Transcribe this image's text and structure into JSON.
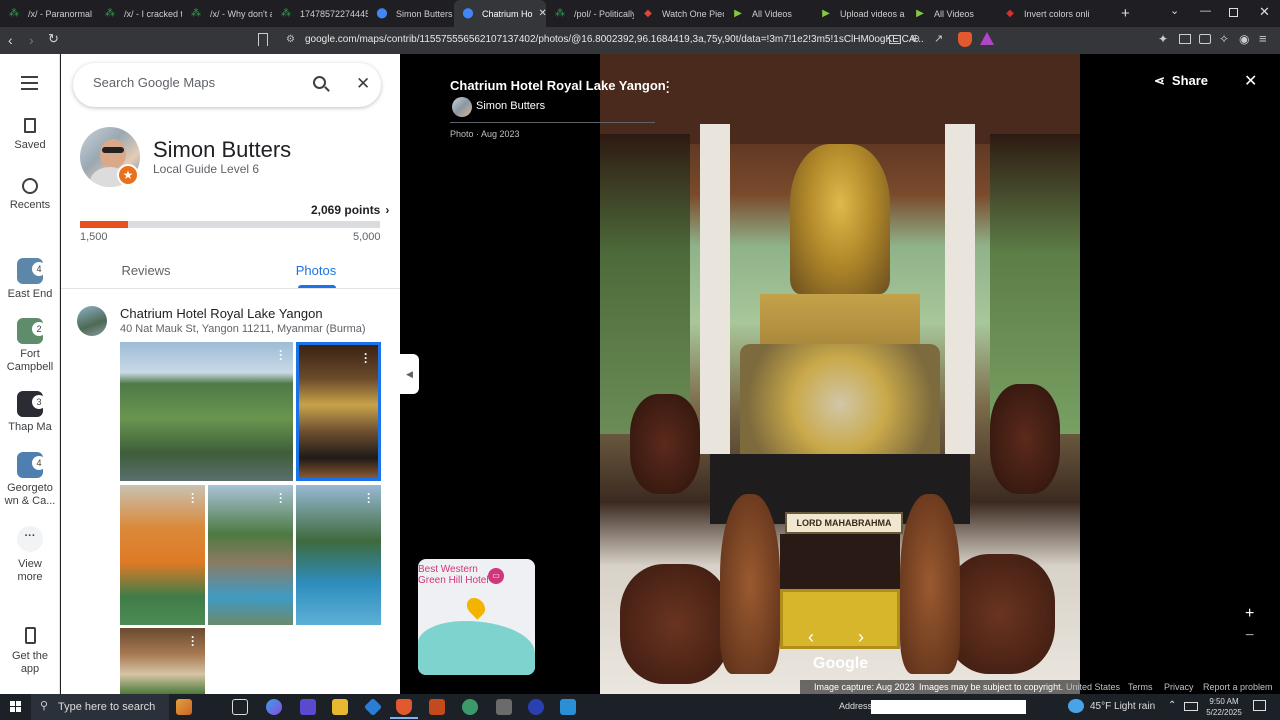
{
  "browser": {
    "tabs": [
      {
        "label": "/x/ - Paranormal",
        "icon": "4chan-icon",
        "color": "#2e9e4f"
      },
      {
        "label": "/x/ - I cracked the",
        "icon": "4chan-icon",
        "color": "#2e9e4f"
      },
      {
        "label": "/x/ - Why don't a",
        "icon": "4chan-icon",
        "color": "#2e9e4f"
      },
      {
        "label": "17478572274445",
        "icon": "4chan-icon",
        "color": "#2e9e4f"
      },
      {
        "label": "Simon Butters - G",
        "icon": "maps-pin-icon",
        "color": "#4285f4"
      },
      {
        "label": "Chatrium Ho",
        "icon": "maps-pin-icon",
        "color": "#4285f4",
        "active": true
      },
      {
        "label": "/pol/ - Politically",
        "icon": "4chan-icon",
        "color": "#2e9e4f"
      },
      {
        "label": "Watch One Piece",
        "icon": "crunchyroll-icon",
        "color": "#e0463a"
      },
      {
        "label": "All Videos",
        "icon": "rumble-icon",
        "color": "#85c742"
      },
      {
        "label": "Upload videos a",
        "icon": "rumble-icon",
        "color": "#85c742"
      },
      {
        "label": "All Videos",
        "icon": "rumble-icon",
        "color": "#85c742"
      },
      {
        "label": "Invert colors onli",
        "icon": "invert-icon",
        "color": "#d9302c"
      }
    ],
    "url": "google.com/maps/contrib/115575556562107137402/photos/@16.8002392,96.1684419,3a,75y,90t/data=!3m7!1e2!3m5!1sClHM0ogKEICA..."
  },
  "rail": {
    "saved": "Saved",
    "recents": "Recents",
    "recent_places": [
      {
        "label": "East End",
        "count": "4",
        "color": "#5d87a8"
      },
      {
        "label": "Fort Campbell",
        "count": "2",
        "color": "#5f8d6b"
      },
      {
        "label": "Thap Ma",
        "count": "3",
        "color": "#2b2b33"
      },
      {
        "label": "Georgeto wn & Ca...",
        "count": "4",
        "color": "#4f7fb0"
      }
    ],
    "view_more": "View more",
    "get_app": "Get the app"
  },
  "search": {
    "placeholder": "Search Google Maps"
  },
  "profile": {
    "name": "Simon Butters",
    "level": "Local Guide Level 6",
    "points": "2,069 points",
    "progress_min": "1,500",
    "progress_max": "5,000",
    "progress_fraction": 0.16
  },
  "tabs": {
    "reviews": "Reviews",
    "photos": "Photos"
  },
  "place": {
    "name": "Chatrium Hotel Royal Lake Yangon",
    "address": "40 Nat Mauk St, Yangon 11211, Myanmar (Burma)"
  },
  "viewer": {
    "title": "Chatrium Hotel Royal Lake Yangon",
    "author": "Simon Butters",
    "date": "Photo · Aug 2023",
    "share": "Share",
    "sign_text": "LORD MAHABRAHMA",
    "google": "Google",
    "capture": "Image capture: Aug 2023",
    "copyright": "Images may be subject to copyright.",
    "footer_links": [
      "United States",
      "Terms",
      "Privacy",
      "Report a problem"
    ],
    "minimap_label": "Best Western Green Hill Hotel"
  },
  "taskbar": {
    "search_placeholder": "Type here to search",
    "address_label": "Address",
    "weather": "45°F  Light rain",
    "time": "9:50 AM",
    "date": "5/22/2025"
  },
  "colors": {
    "accent": "#1a73e8",
    "progress": "#e8501f",
    "taskbar": "#1c2128"
  }
}
